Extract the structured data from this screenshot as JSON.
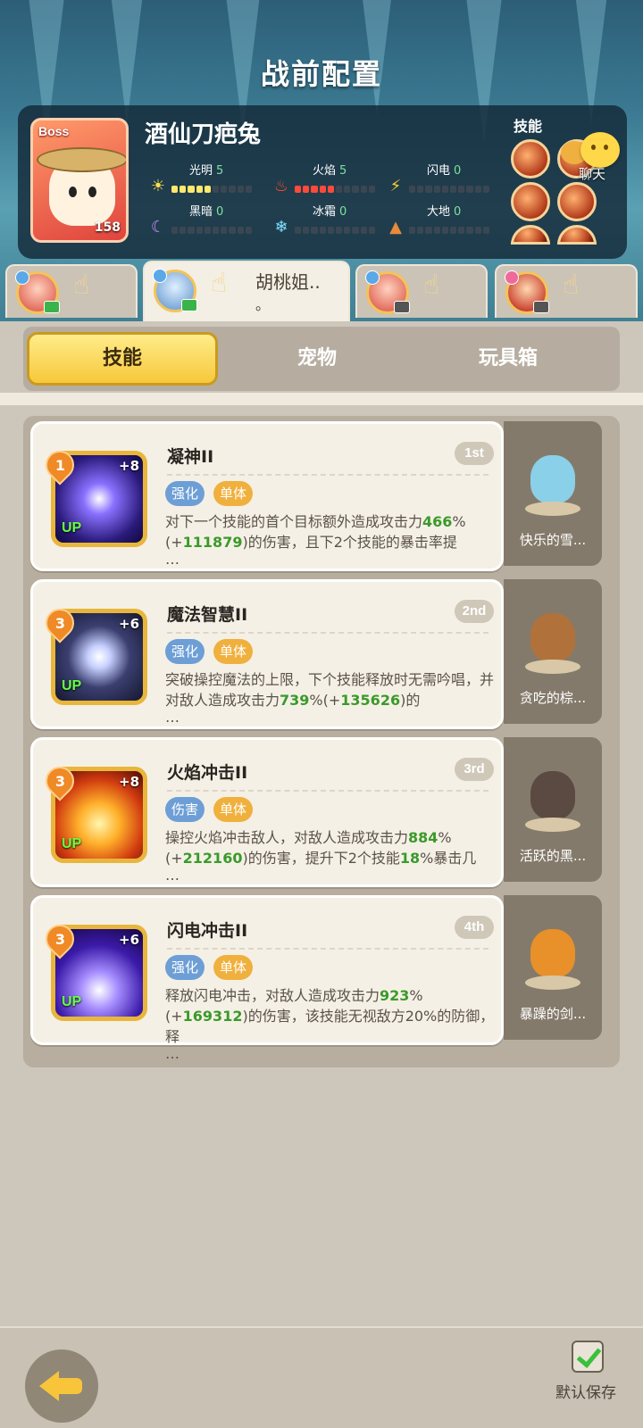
{
  "page_title": "战前配置",
  "boss": {
    "tag": "Boss",
    "name": "酒仙刀疤兔",
    "level": "158",
    "elements": [
      {
        "name": "光明",
        "value": "5",
        "icon": "sun-icon",
        "filled": 5,
        "color": "#ffe86a"
      },
      {
        "name": "火焰",
        "value": "5",
        "icon": "flame-icon",
        "filled": 5,
        "color": "#ff4a3a"
      },
      {
        "name": "闪电",
        "value": "0",
        "icon": "lightning-icon",
        "filled": 0,
        "color": "#ffe86a"
      },
      {
        "name": "黑暗",
        "value": "0",
        "icon": "moon-icon",
        "filled": 0,
        "color": "#b070ff"
      },
      {
        "name": "冰霜",
        "value": "0",
        "icon": "snowflake-icon",
        "filled": 0,
        "color": "#80e0ff"
      },
      {
        "name": "大地",
        "value": "0",
        "icon": "earth-icon",
        "filled": 0,
        "color": "#e88a3a"
      }
    ],
    "skills_label": "技能",
    "chat_label": "聊天"
  },
  "heroes": [
    {
      "name": "",
      "active": false
    },
    {
      "name": "胡桃姐..",
      "name2": "。",
      "active": true
    },
    {
      "name": "",
      "active": false
    },
    {
      "name": "",
      "active": false
    }
  ],
  "categories": [
    {
      "label": "技能",
      "active": true
    },
    {
      "label": "宠物",
      "active": false
    },
    {
      "label": "玩具箱",
      "active": false
    }
  ],
  "skills": [
    {
      "level": "1",
      "plus": "+8",
      "up": "UP",
      "name": "凝神II",
      "order": "1st",
      "tags": [
        {
          "label": "强化",
          "color": "blue"
        },
        {
          "label": "单体",
          "color": "orange"
        }
      ],
      "desc_a": "对下一个技能的首个目标额外造成攻击力",
      "desc_g1": "466",
      "desc_b": "%(+",
      "desc_g2": "111879",
      "desc_c": ")的伤害，且下2个技能的暴击率提",
      "ellipsis": "…",
      "pet": "快乐的雪..."
    },
    {
      "level": "3",
      "plus": "+6",
      "up": "UP",
      "name": "魔法智慧II",
      "order": "2nd",
      "tags": [
        {
          "label": "强化",
          "color": "blue"
        },
        {
          "label": "单体",
          "color": "orange"
        }
      ],
      "desc_a": "突破操控魔法的上限，下个技能释放时无需吟唱，并对敌人造成攻击力",
      "desc_g1": "739",
      "desc_b": "%(+",
      "desc_g2": "135626",
      "desc_c": ")的",
      "ellipsis": "…",
      "pet": "贪吃的棕..."
    },
    {
      "level": "3",
      "plus": "+8",
      "up": "UP",
      "name": "火焰冲击II",
      "order": "3rd",
      "tags": [
        {
          "label": "伤害",
          "color": "blue"
        },
        {
          "label": "单体",
          "color": "orange"
        }
      ],
      "desc_a": "操控火焰冲击敌人，对敌人造成攻击力",
      "desc_g1": "884",
      "desc_b": "%(+",
      "desc_g2": "212160",
      "desc_c": ")的伤害，提升下2个技能",
      "desc_g3": "18",
      "desc_d": "%暴击几",
      "ellipsis": "…",
      "pet": "活跃的黑..."
    },
    {
      "level": "3",
      "plus": "+6",
      "up": "UP",
      "name": "闪电冲击II",
      "order": "4th",
      "tags": [
        {
          "label": "强化",
          "color": "blue"
        },
        {
          "label": "单体",
          "color": "orange"
        }
      ],
      "desc_a": "释放闪电冲击，对敌人造成攻击力",
      "desc_g1": "923",
      "desc_b": "%(+",
      "desc_g2": "169312",
      "desc_c": ")的伤害，该技能无视敌方20%的防御，释",
      "ellipsis": "…",
      "pet": "暴躁的剑..."
    }
  ],
  "footer": {
    "save_label": "默认保存"
  }
}
